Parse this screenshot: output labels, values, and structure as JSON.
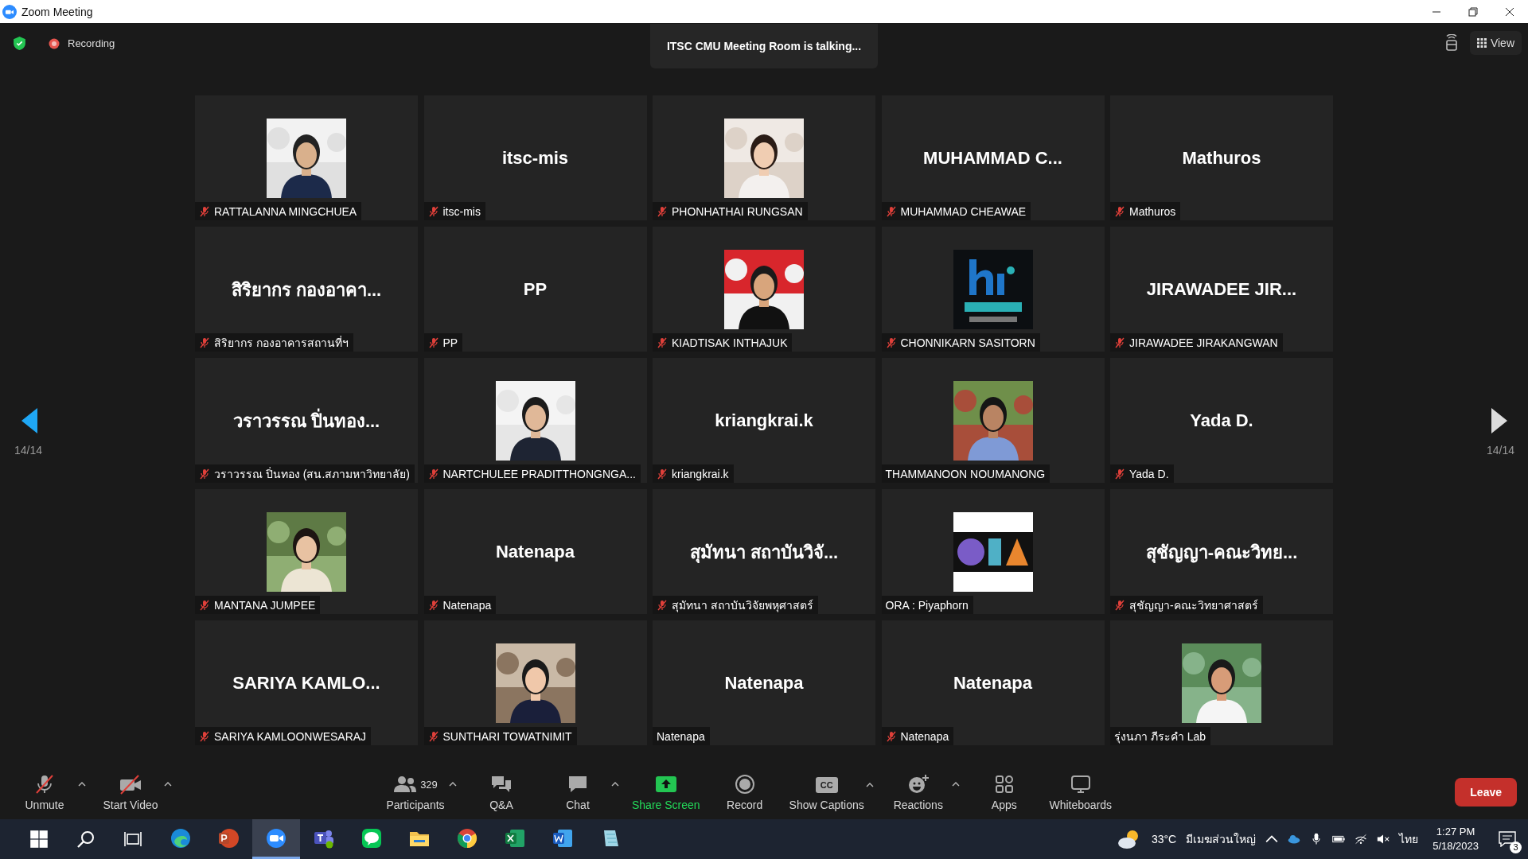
{
  "window": {
    "title": "Zoom Meeting"
  },
  "top_bar": {
    "recording_label": "Recording",
    "talking_banner": "ITSC CMU Meeting Room is talking...",
    "view_label": "View"
  },
  "pager": {
    "left": "14/14",
    "right": "14/14"
  },
  "tiles": [
    {
      "name": "RATTALANNA MINGCHUEA",
      "muted": true
    },
    {
      "kind": "name",
      "display": "itsc-mis",
      "name": "itsc-mis",
      "muted": true
    },
    {
      "name": "PHONHATHAI RUNGSAN",
      "muted": true
    },
    {
      "kind": "name",
      "display": "MUHAMMAD  C...",
      "name": "MUHAMMAD CHEAWAE",
      "muted": true
    },
    {
      "kind": "name",
      "display": "Mathuros",
      "name": "Mathuros",
      "muted": true
    },
    {
      "kind": "name",
      "display": "สิริยากร กองอาคา...",
      "name": "สิริยากร กองอาคารสถานที่ฯ",
      "muted": true
    },
    {
      "kind": "name",
      "display": "PP",
      "name": "PP",
      "muted": true
    },
    {
      "name": "KIADTISAK INTHAJUK",
      "muted": true
    },
    {
      "kind": "logo",
      "name": "CHONNIKARN SASITORN",
      "muted": true
    },
    {
      "kind": "name",
      "display": "JIRAWADEE  JIR...",
      "name": "JIRAWADEE JIRAKANGWAN",
      "muted": true
    },
    {
      "kind": "name",
      "display": "วราวรรณ ปิ่นทอง...",
      "name": "วราวรรณ ปิ่นทอง (สน.สภามหาวิทยาลัย)",
      "muted": true
    },
    {
      "name": "NARTCHULEE PRADITTHONGNGA...",
      "muted": true
    },
    {
      "kind": "name",
      "display": "kriangkrai.k",
      "name": "kriangkrai.k",
      "muted": true
    },
    {
      "name": "THAMMANOON NOUMANONG",
      "muted": false
    },
    {
      "kind": "name",
      "display": "Yada D.",
      "name": "Yada D.",
      "muted": true
    },
    {
      "name": "MANTANA JUMPEE",
      "muted": true
    },
    {
      "kind": "name",
      "display": "Natenapa",
      "name": "Natenapa",
      "muted": true
    },
    {
      "kind": "name",
      "display": "สุมัทนา สถาบันวิจั...",
      "name": "สุมัทนา สถาบันวิจัยพหุศาสตร์",
      "muted": true
    },
    {
      "kind": "logo",
      "name": "ORA : Piyaphorn",
      "muted": false
    },
    {
      "kind": "name",
      "display": "สุชัญญา-คณะวิทย...",
      "name": "สุชัญญา-คณะวิทยาศาสตร์",
      "muted": true
    },
    {
      "kind": "name",
      "display": "SARIYA  KAMLO...",
      "name": "SARIYA KAMLOONWESARAJ",
      "muted": true
    },
    {
      "name": "SUNTHARI TOWATNIMIT",
      "muted": true
    },
    {
      "kind": "name",
      "display": "Natenapa",
      "name": "Natenapa",
      "muted": false
    },
    {
      "kind": "name",
      "display": "Natenapa",
      "name": "Natenapa",
      "muted": true
    },
    {
      "name": "รุ่งนภา ภีระคำ Lab",
      "muted": false
    }
  ],
  "toolbar": {
    "buttons": [
      {
        "kind": "mic",
        "label": "Unmute",
        "caret": true
      },
      {
        "kind": "video",
        "label": "Start Video",
        "caret": true
      },
      {
        "kind": "participants",
        "label": "Participants",
        "count": "329",
        "caret": true
      },
      {
        "kind": "qa",
        "label": "Q&A",
        "caret": false
      },
      {
        "kind": "chat",
        "label": "Chat",
        "caret": true
      },
      {
        "kind": "share",
        "label": "Share Screen",
        "caret": false
      },
      {
        "kind": "record",
        "label": "Record",
        "caret": false
      },
      {
        "kind": "captions",
        "label": "Show Captions",
        "icon_text": "CC",
        "caret": true
      },
      {
        "kind": "reactions",
        "label": "Reactions",
        "caret": true
      },
      {
        "kind": "apps",
        "label": "Apps",
        "caret": false
      },
      {
        "kind": "whiteboards",
        "label": "Whiteboards",
        "caret": false
      }
    ],
    "leave": "Leave"
  },
  "taskbar": {
    "apps": [
      {
        "kind": "edge",
        "selected": false
      },
      {
        "kind": "powerpoint",
        "selected": false
      },
      {
        "kind": "zoom",
        "selected": true
      },
      {
        "kind": "teams",
        "selected": false
      },
      {
        "kind": "line",
        "selected": false
      },
      {
        "kind": "explorer",
        "selected": false
      },
      {
        "kind": "chrome",
        "selected": false
      },
      {
        "kind": "excel",
        "selected": false
      },
      {
        "kind": "word",
        "selected": false
      },
      {
        "kind": "notes",
        "selected": false
      }
    ],
    "temperature": "33°C",
    "weather": "มีเมฆส่วนใหญ่",
    "language": "ไทย",
    "time": "1:27 PM",
    "date": "5/18/2023",
    "notifications": "3"
  }
}
